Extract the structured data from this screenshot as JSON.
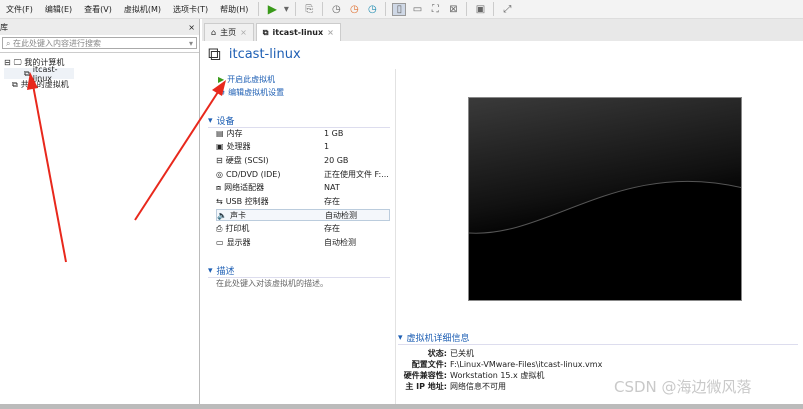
{
  "menu": [
    "文件(F)",
    "编辑(E)",
    "查看(V)",
    "虚拟机(M)",
    "选项卡(T)",
    "帮助(H)"
  ],
  "library": {
    "title": "库",
    "close": "×",
    "search_placeholder": "在此处键入内容进行搜索",
    "tree": [
      {
        "label": "我的计算机",
        "toggle": "⊟"
      },
      {
        "label": "itcast-linux"
      },
      {
        "label": "共享的虚拟机"
      }
    ]
  },
  "tabs": [
    {
      "label": "主页"
    },
    {
      "label": "itcast-linux"
    }
  ],
  "vm": {
    "title": "itcast-linux",
    "actions": [
      "开启此虚拟机",
      "编辑虚拟机设置"
    ],
    "devices_header": "设备",
    "devices": [
      {
        "name": "内存",
        "value": "1 GB",
        "icon": "memory-icon"
      },
      {
        "name": "处理器",
        "value": "1",
        "icon": "cpu-icon"
      },
      {
        "name": "硬盘 (SCSI)",
        "value": "20 GB",
        "icon": "disk-icon"
      },
      {
        "name": "CD/DVD (IDE)",
        "value": "正在使用文件 F:...",
        "icon": "cd-icon"
      },
      {
        "name": "网络适配器",
        "value": "NAT",
        "icon": "network-icon"
      },
      {
        "name": "USB 控制器",
        "value": "存在",
        "icon": "usb-icon"
      },
      {
        "name": "声卡",
        "value": "自动检测",
        "icon": "sound-icon"
      },
      {
        "name": "打印机",
        "value": "存在",
        "icon": "printer-icon"
      },
      {
        "name": "显示器",
        "value": "自动检测",
        "icon": "display-icon"
      }
    ],
    "desc_header": "描述",
    "desc_placeholder": "在此处键入对该虚拟机的描述。",
    "details_header": "虚拟机详细信息",
    "details": [
      {
        "k": "状态:",
        "v": "已关机"
      },
      {
        "k": "配置文件:",
        "v": "F:\\Linux-VMware-Files\\itcast-linux.vmx"
      },
      {
        "k": "硬件兼容性:",
        "v": "Workstation 15.x 虚拟机"
      },
      {
        "k": "主 IP 地址:",
        "v": "网络信息不可用"
      }
    ]
  },
  "watermark": "CSDN @海边微风落",
  "colors": {
    "accent": "#1e5fb4",
    "play": "#3a9a1a",
    "arrow": "#e8281c"
  }
}
